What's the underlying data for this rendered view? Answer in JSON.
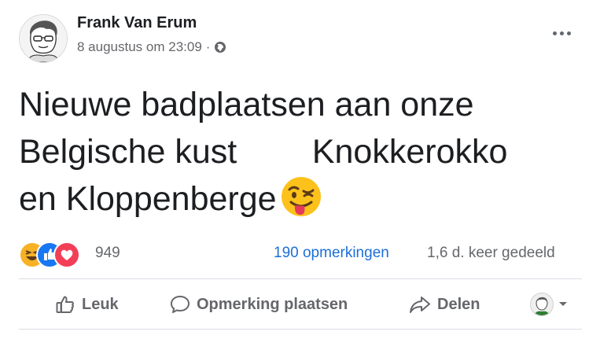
{
  "post": {
    "author": "Frank Van Erum",
    "timestamp": "8 augustus om 23:09",
    "separator": "·",
    "privacy_icon": "globe-icon",
    "more_icon": "more-options-icon",
    "text": "Nieuwe badplaatsen aan onze\nBelgische kust        Knokkerokko\nen Kloppenberge",
    "text_emoji": "winking-face-tongue-emoji"
  },
  "engagement": {
    "reactions": [
      "haha-reaction-icon",
      "like-reaction-icon",
      "love-reaction-icon"
    ],
    "reaction_count": "949",
    "comments": "190 opmerkingen",
    "shares": "1,6 d. keer gedeeld"
  },
  "actions": {
    "like": "Leuk",
    "comment": "Opmerking plaatsen",
    "share": "Delen"
  },
  "colors": {
    "link": "#1c6fd8",
    "secondary_text": "#65676b",
    "like_blue": "#1877f2",
    "love_red": "#f33e58",
    "haha_yellow": "#f7b125"
  }
}
